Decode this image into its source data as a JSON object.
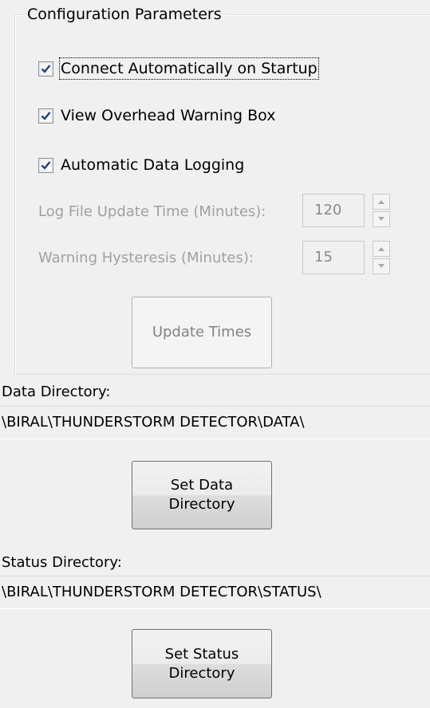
{
  "group": {
    "title": "Configuration Parameters"
  },
  "checkboxes": [
    {
      "label": "Connect Automatically on Startup",
      "checked": true
    },
    {
      "label": "View Overhead Warning Box",
      "checked": true
    },
    {
      "label": "Automatic  Data Logging",
      "checked": true
    }
  ],
  "log_time": {
    "label": "Log File Update Time  (Minutes):",
    "value": "120"
  },
  "hysteresis": {
    "label": "Warning Hysteresis (Minutes):",
    "value": "15"
  },
  "update_button": {
    "label": "Update Times"
  },
  "data_dir": {
    "label": "Data Directory:",
    "path": "\\BIRAL\\THUNDERSTORM DETECTOR\\DATA\\",
    "button_line1": "Set Data",
    "button_line2": "Directory"
  },
  "status_dir": {
    "label": "Status Directory:",
    "path": "\\BIRAL\\THUNDERSTORM DETECTOR\\STATUS\\",
    "button_line1": "Set Status",
    "button_line2": "Directory"
  },
  "icons": {
    "check": "check-icon",
    "spin_up": "arrow-up-icon",
    "spin_down": "arrow-down-icon"
  },
  "colors": {
    "background": "#f0f0f0",
    "disabled_text": "#a0a0a0",
    "check_mark": "#1f3f7a"
  }
}
